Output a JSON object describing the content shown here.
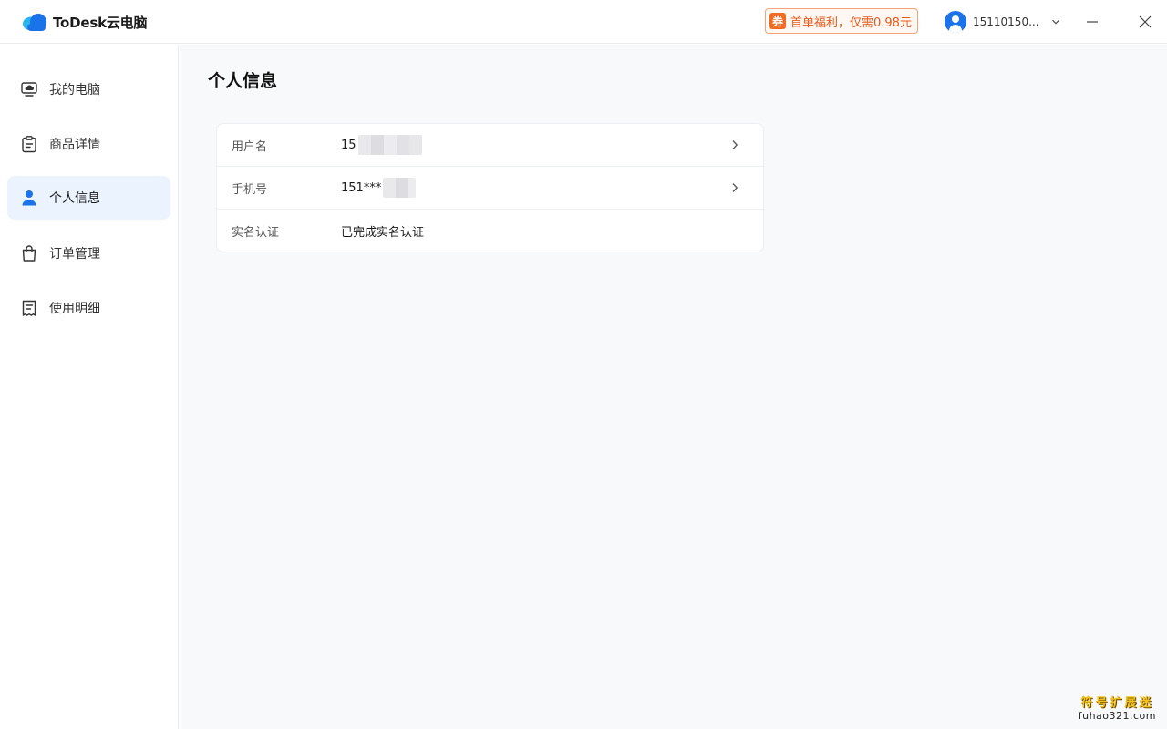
{
  "app": {
    "logo_text": "ToDesk云电脑"
  },
  "promo": {
    "badge": "券",
    "text": "首单福利，仅需0.98元"
  },
  "account": {
    "name": "15110150..."
  },
  "sidebar": {
    "items": [
      {
        "label": "我的电脑",
        "icon": "monitor-cloud-icon",
        "active": false
      },
      {
        "label": "商品详情",
        "icon": "clipboard-icon",
        "active": false
      },
      {
        "label": "个人信息",
        "icon": "user-icon",
        "active": true
      },
      {
        "label": "订单管理",
        "icon": "shopping-bag-icon",
        "active": false
      },
      {
        "label": "使用明细",
        "icon": "receipt-icon",
        "active": false
      }
    ]
  },
  "main": {
    "title": "个人信息",
    "rows": [
      {
        "label": "用户名",
        "value": "15",
        "has_chevron": true
      },
      {
        "label": "手机号",
        "value": "151***",
        "has_chevron": true
      },
      {
        "label": "实名认证",
        "value": "已完成实名认证",
        "has_chevron": false
      }
    ]
  },
  "watermark": {
    "title": "符号扩展迷",
    "url": "fuhao321.com"
  },
  "colors": {
    "brand_blue": "#1a73e8",
    "active_bg": "#eaf3fe",
    "promo_orange": "#f26b21",
    "main_bg": "#f8f9fb"
  }
}
